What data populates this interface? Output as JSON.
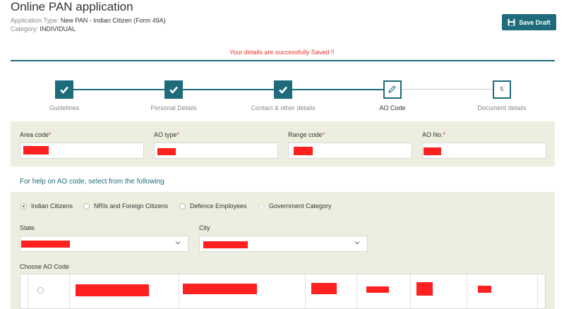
{
  "header": {
    "title": "Online PAN application",
    "application_type_label": "Application Type: ",
    "application_type_value": "New PAN - Indian Citizen (Form 49A)",
    "category_label": "Category: ",
    "category_value": "INDIVIDUAL",
    "save_draft_label": "Save Draft"
  },
  "status": {
    "success_message": "Your details are successfully Saved !!"
  },
  "stepper": {
    "steps": [
      {
        "label": "Guidelines",
        "state": "done"
      },
      {
        "label": "Personal Details",
        "state": "done"
      },
      {
        "label": "Contact & other details",
        "state": "done"
      },
      {
        "label": "AO Code",
        "state": "current"
      },
      {
        "label": "Document details",
        "state": "todo",
        "number": "5"
      }
    ]
  },
  "ao_fields": {
    "area_code_label": "Area code",
    "ao_type_label": "AO type",
    "range_code_label": "Range code",
    "ao_no_label": "AO No.",
    "required_mark": "*"
  },
  "ao_lookup": {
    "help_text": "For help on AO code, select from the following",
    "options": [
      {
        "label": "Indian Citizens",
        "checked": true,
        "disabled": false
      },
      {
        "label": "NRIs and Foreign Citizens",
        "checked": false,
        "disabled": false
      },
      {
        "label": "Defence Employees",
        "checked": false,
        "disabled": false
      },
      {
        "label": "Government Category",
        "checked": false,
        "disabled": true
      }
    ],
    "state_label": "State",
    "city_label": "City",
    "choose_label": "Choose AO Code"
  },
  "colors": {
    "accent": "#1e6b7b",
    "panel_bg": "#eeeee0",
    "success_text": "#e8312f",
    "redaction": "#ff2020"
  }
}
